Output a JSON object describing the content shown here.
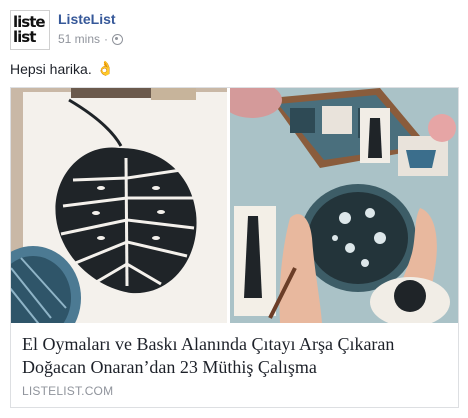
{
  "post": {
    "avatar": {
      "line1": "liste",
      "line2": "list"
    },
    "author_name": "ListeList",
    "timestamp": "51 mins",
    "separator": "·",
    "privacy_icon": "globe-icon",
    "text": "Hepsi harika.",
    "emoji": "👌"
  },
  "link_preview": {
    "title": "El Oymaları ve Baskı Alanında Çıtayı Arşa Çıkaran Doğacan Onaran’dan 23 Müthiş Çalışma",
    "domain": "LISTELIST.COM",
    "images": [
      "monstera-leaf-linocut-print",
      "hand-carved-stamps-on-table"
    ]
  },
  "colors": {
    "author": "#365899",
    "meta": "#90949c",
    "text": "#1d2129",
    "border": "#dddfe2"
  }
}
